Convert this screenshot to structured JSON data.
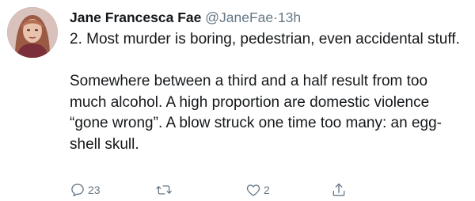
{
  "tweet": {
    "author_name": "Jane Francesca Fae",
    "handle": "@JaneFae",
    "separator": "·",
    "time": "13h",
    "paragraph_1": "2.  Most murder is boring, pedestrian, even accidental stuff.",
    "paragraph_2": "Somewhere between a third and a half result from too much alcohol. A high proportion are domestic violence “gone wrong”. A blow struck one time too many: an egg-shell skull."
  },
  "actions": {
    "reply": {
      "icon": "reply-icon",
      "count": "23"
    },
    "retweet": {
      "icon": "retweet-icon"
    },
    "like": {
      "icon": "heart-icon",
      "count": "2"
    },
    "share": {
      "icon": "share-icon"
    }
  },
  "colors": {
    "text": "#14171a",
    "muted": "#657786",
    "background": "#ffffff"
  }
}
